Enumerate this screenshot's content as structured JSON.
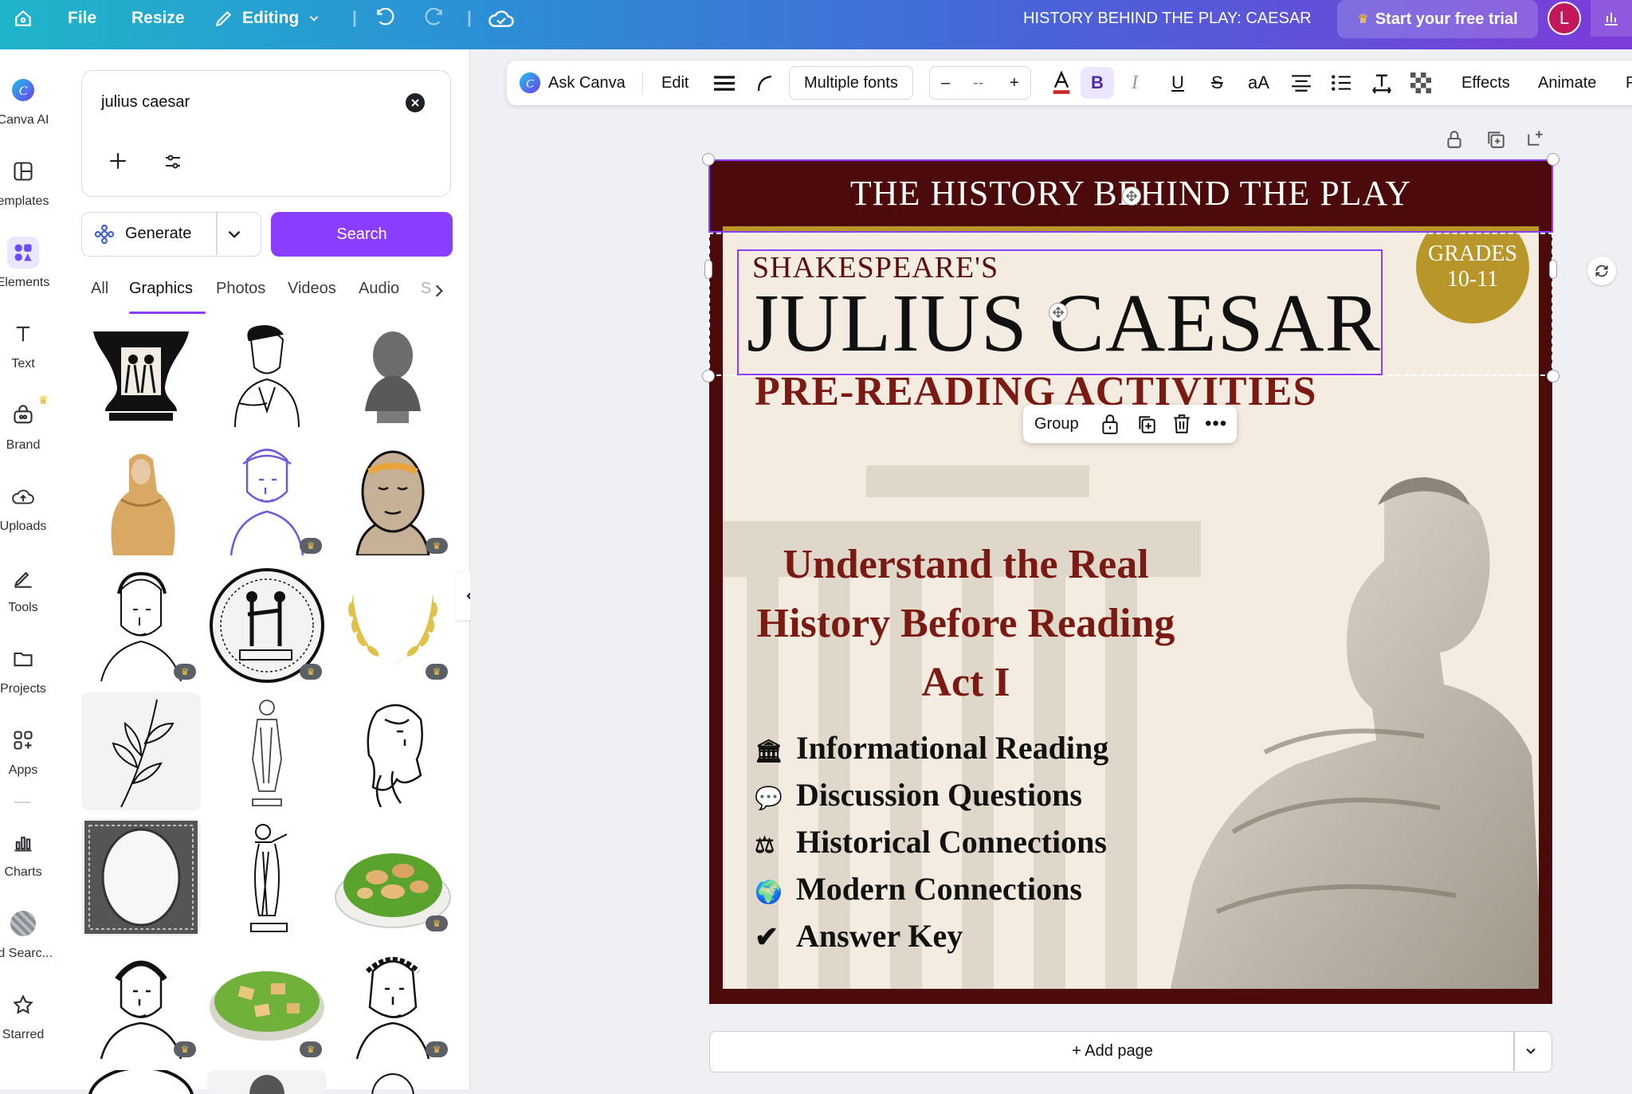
{
  "topbar": {
    "home_icon": "home-icon",
    "file": "File",
    "resize": "Resize",
    "editing": "Editing",
    "doc_title": "HISTORY BEHIND THE PLAY: CAESAR",
    "trial": "Start your free trial",
    "avatar": "L"
  },
  "rail": [
    {
      "label": "Canva AI",
      "icon": "canva-ai-icon"
    },
    {
      "label": "emplates",
      "icon": "templates-icon"
    },
    {
      "label": "Elements",
      "icon": "elements-icon"
    },
    {
      "label": "Text",
      "icon": "text-icon"
    },
    {
      "label": "Brand",
      "icon": "brand-icon"
    },
    {
      "label": "Uploads",
      "icon": "uploads-icon"
    },
    {
      "label": "Tools",
      "icon": "tools-icon"
    },
    {
      "label": "Projects",
      "icon": "projects-icon"
    },
    {
      "label": "Apps",
      "icon": "apps-icon"
    },
    {
      "label": "Charts",
      "icon": "charts-icon"
    },
    {
      "label": "rd Searc...",
      "icon": "search-app-icon"
    },
    {
      "label": "Starred",
      "icon": "star-icon"
    }
  ],
  "panel": {
    "search_value": "julius caesar",
    "generate": "Generate",
    "search_button": "Search",
    "tabs": [
      "All",
      "Graphics",
      "Photos",
      "Videos",
      "Audio",
      "S"
    ],
    "active_tab": "Graphics"
  },
  "toolbar": {
    "ask_canva": "Ask Canva",
    "edit": "Edit",
    "font": "Multiple fonts",
    "size_minus": "–",
    "size_value": "--",
    "size_plus": "+",
    "bold": "B",
    "italic": "I",
    "underline": "U",
    "strike": "S",
    "case": "aA",
    "effects": "Effects",
    "animate": "Animate",
    "more": "P"
  },
  "design": {
    "banner": "THE HISTORY BEHIND THE PLAY",
    "grades_line1": "GRADES",
    "grades_line2": "10-11",
    "shakespeare": "SHAKESPEARE'S",
    "title": "JULIUS CAESAR",
    "subtitle": "PRE-READING ACTIVITIES",
    "tag_line1": "Understand the Real",
    "tag_line2": "History Before Reading",
    "tag_line3": "Act I",
    "list": [
      {
        "icon": "🏛",
        "text": "Informational Reading"
      },
      {
        "icon": "💬",
        "text": "Discussion Questions"
      },
      {
        "icon": "⚖",
        "text": "Historical Connections"
      },
      {
        "icon": "🌍",
        "text": "Modern Connections"
      },
      {
        "icon": "✔",
        "text": "Answer Key"
      }
    ]
  },
  "group_menu": {
    "label": "Group"
  },
  "add_page": "+ Add page",
  "colors": {
    "accent": "#8b3dff",
    "maroon": "#4d0a0a",
    "gold": "#b9962a",
    "title_red": "#7a1a12"
  }
}
